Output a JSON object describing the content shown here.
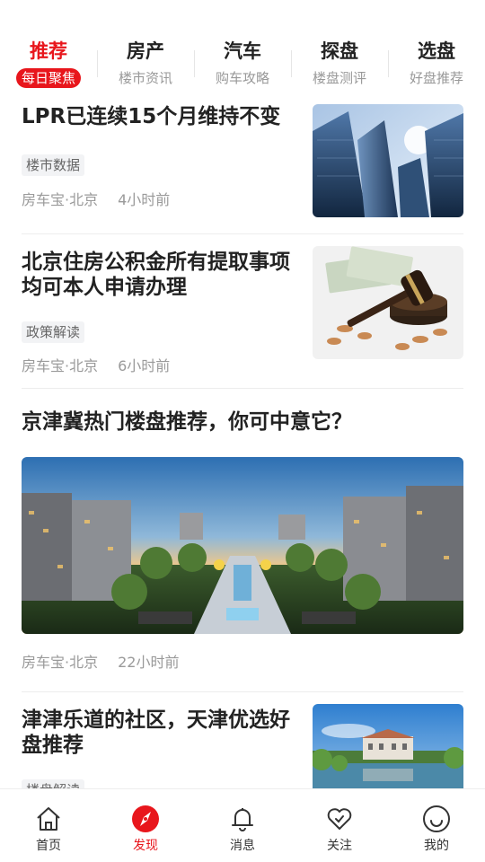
{
  "tabs": [
    {
      "title": "推荐",
      "subtitle": "每日聚焦",
      "active": true
    },
    {
      "title": "房产",
      "subtitle": "楼市资讯"
    },
    {
      "title": "汽车",
      "subtitle": "购车攻略"
    },
    {
      "title": "探盘",
      "subtitle": "楼盘测评"
    },
    {
      "title": "选盘",
      "subtitle": "好盘推荐"
    }
  ],
  "feed": [
    {
      "title": "LPR已连续15个月维持不变",
      "tag": "楼市数据",
      "source": "房车宝·北京",
      "time": "4小时前",
      "image": "skyscraper-photo"
    },
    {
      "title": "北京住房公积金所有提取事项均可本人申请办理",
      "tag": "政策解读",
      "source": "房车宝·北京",
      "time": "6小时前",
      "image": "gavel-money-photo"
    },
    {
      "title": "京津冀热门楼盘推荐，你可中意它？",
      "source": "房车宝·北京",
      "time": "22小时前",
      "image": "residential-complex-photo"
    },
    {
      "title": "津津乐道的社区，天津优选好盘推荐",
      "tag": "楼盘解读",
      "image": "lakeside-villa-photo"
    }
  ],
  "bottom_nav": [
    {
      "label": "首页",
      "icon": "home-icon"
    },
    {
      "label": "发现",
      "icon": "compass-icon",
      "active": true
    },
    {
      "label": "消息",
      "icon": "bell-icon"
    },
    {
      "label": "关注",
      "icon": "heart-icon"
    },
    {
      "label": "我的",
      "icon": "smile-icon"
    }
  ],
  "colors": {
    "accent": "#e8161c",
    "text": "#222222",
    "muted": "#999999"
  }
}
